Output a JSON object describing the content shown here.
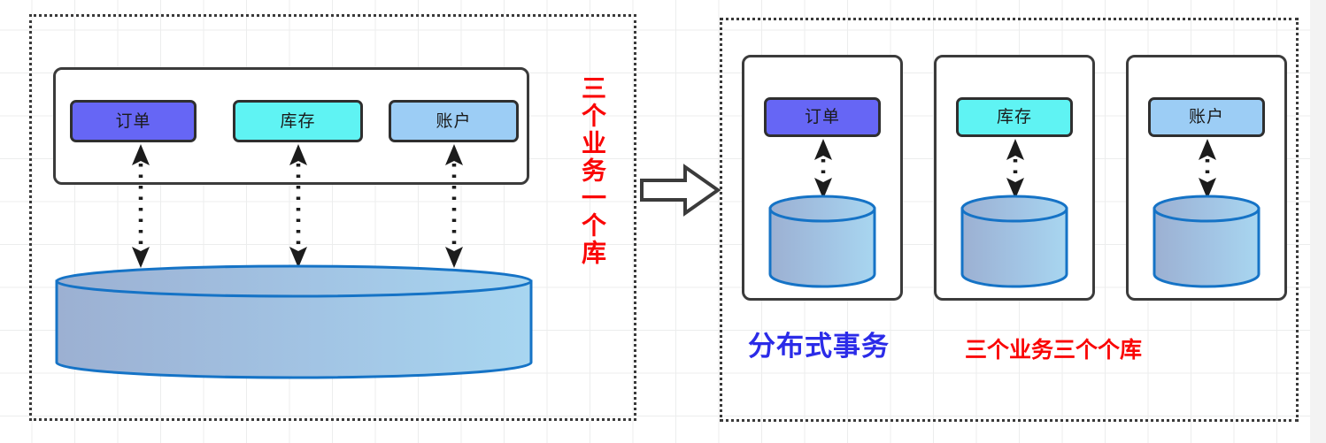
{
  "diagram": {
    "title_vertical_note": "三个业务一个库",
    "colors": {
      "chip_order": "#6666f5",
      "chip_inventory": "#5ff3f3",
      "chip_account": "#9ccdf5",
      "cylinder_stroke": "#1573c6",
      "cylinder_fill_left": "#9fb3d4",
      "cylinder_fill_right": "#a5d4ee",
      "annotation_red": "#fa0505",
      "annotation_blue": "#2b2be8",
      "border_dark": "#3b3b3b",
      "grid_line": "#eceded"
    },
    "left_panel": {
      "name": "monolithic-single-database",
      "services_container_label": "services-container",
      "services": [
        {
          "label": "订单",
          "fill": "#6666f5"
        },
        {
          "label": "库存",
          "fill": "#5ff3f3"
        },
        {
          "label": "账户",
          "fill": "#9ccdf5"
        }
      ],
      "database": {
        "label": "",
        "shape": "cylinder"
      },
      "annotation": "三个业务一个库"
    },
    "transition": {
      "icon": "block-arrow-right-icon"
    },
    "right_panel": {
      "name": "distributed-services-databases",
      "cards": [
        {
          "service": "订单",
          "fill": "#6666f5",
          "database": "cylinder"
        },
        {
          "service": "库存",
          "fill": "#5ff3f3",
          "database": "cylinder"
        },
        {
          "service": "账户",
          "fill": "#9ccdf5",
          "database": "cylinder"
        }
      ],
      "annotations": {
        "distributed_transaction": "分布式事务",
        "three_services_three_databases": "三个业务三个个库"
      }
    }
  }
}
